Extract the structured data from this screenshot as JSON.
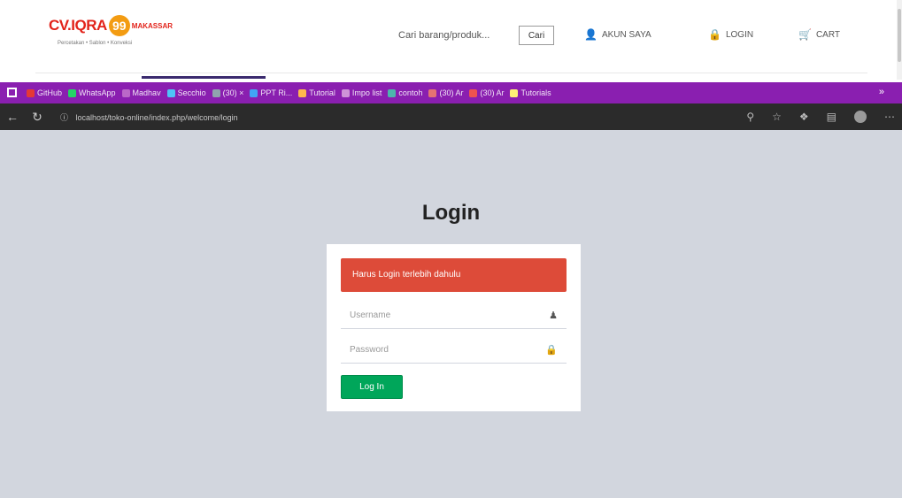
{
  "site": {
    "logo_cv": "CV.IQRA",
    "logo_99": "99",
    "logo_sub": "MAKASSAR",
    "logo_tagline": "Percetakan • Sablon • Konveksi",
    "search_placeholder": "Cari barang/produk...",
    "search_button": "Cari",
    "account_label": "AKUN SAYA",
    "login_label": "LOGIN",
    "cart_label": "CART"
  },
  "browser": {
    "bookmarks": [
      {
        "label": "GitHub",
        "color": "#e53935"
      },
      {
        "label": "WhatsApp",
        "color": "#25d366"
      },
      {
        "label": "Madhav",
        "color": "#ba68c8"
      },
      {
        "label": "Secchio",
        "color": "#4fc3f7"
      },
      {
        "label": "(30) ×",
        "color": "#90a4ae"
      },
      {
        "label": "PPT Ri...",
        "color": "#42a5f5"
      },
      {
        "label": "Tutorial",
        "color": "#ffb74d"
      },
      {
        "label": "Impo list",
        "color": "#ce93d8"
      },
      {
        "label": "contoh",
        "color": "#4db6ac"
      },
      {
        "label": "(30) Ar",
        "color": "#e57373"
      },
      {
        "label": "(30) Ar",
        "color": "#ef5350"
      },
      {
        "label": "Tutorials",
        "color": "#fff176"
      }
    ],
    "url": "localhost/toko-online/index.php/welcome/login"
  },
  "login": {
    "title": "Login",
    "alert": "Harus Login terlebih dahulu",
    "username_placeholder": "Username",
    "password_placeholder": "Password",
    "submit_label": "Log In"
  }
}
